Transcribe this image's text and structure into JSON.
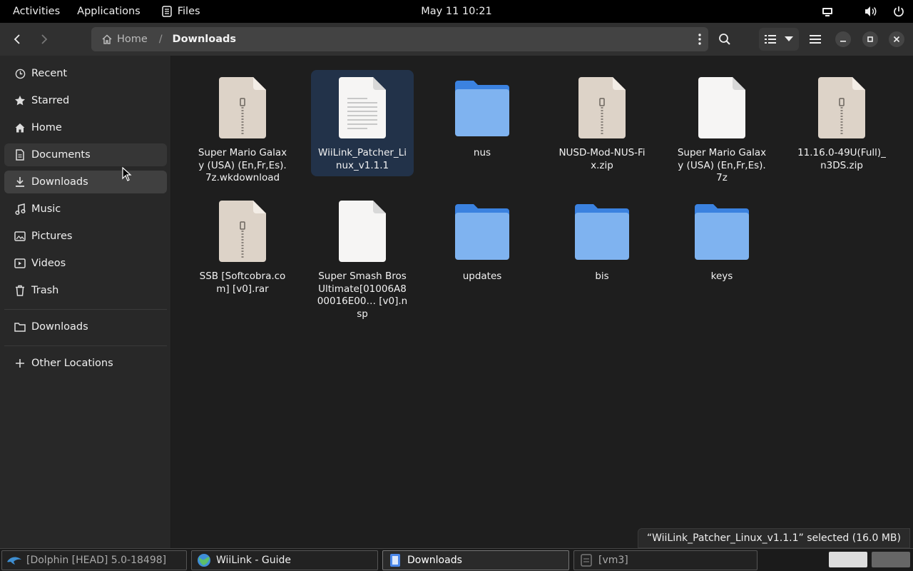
{
  "topbar": {
    "activities": "Activities",
    "applications": "Applications",
    "app_name": "Files",
    "clock": "May 11  10:21"
  },
  "header": {
    "breadcrumb_home": "Home",
    "breadcrumb_sep": "/",
    "breadcrumb_current": "Downloads"
  },
  "sidebar": {
    "items": [
      {
        "label": "Recent",
        "icon": "clock-icon"
      },
      {
        "label": "Starred",
        "icon": "star-icon"
      },
      {
        "label": "Home",
        "icon": "home-icon"
      },
      {
        "label": "Documents",
        "icon": "document-icon"
      },
      {
        "label": "Downloads",
        "icon": "download-icon"
      },
      {
        "label": "Music",
        "icon": "music-icon"
      },
      {
        "label": "Pictures",
        "icon": "picture-icon"
      },
      {
        "label": "Videos",
        "icon": "video-icon"
      },
      {
        "label": "Trash",
        "icon": "trash-icon"
      }
    ],
    "bookmark": {
      "label": "Downloads",
      "icon": "folder-icon"
    },
    "other_locations": {
      "label": "Other Locations",
      "icon": "plus-icon"
    }
  },
  "files": [
    {
      "name": "Super Mario Galaxy (USA) (En,Fr,Es).7z.wkdownload",
      "type": "archive"
    },
    {
      "name": "WiiLink_Patcher_Linux_v1.1.1",
      "type": "text",
      "selected": true
    },
    {
      "name": "nus",
      "type": "folder"
    },
    {
      "name": "NUSD-Mod-NUS-Fix.zip",
      "type": "archive"
    },
    {
      "name": "Super Mario Galaxy (USA) (En,Fr,Es).7z",
      "type": "blank"
    },
    {
      "name": "11.16.0-49U(Full)_n3DS.zip",
      "type": "archive"
    },
    {
      "name": "SSB [Softcobra.com] [v0].rar",
      "type": "archive"
    },
    {
      "name": "Super Smash Bros Ultimate[01006A800016E00… [v0].nsp",
      "type": "blank"
    },
    {
      "name": "updates",
      "type": "folder"
    },
    {
      "name": "bis",
      "type": "folder"
    },
    {
      "name": "keys",
      "type": "folder"
    }
  ],
  "status": "“WiiLink_Patcher_Linux_v1.1.1” selected  (16.0 MB)",
  "taskbar": {
    "tasks": [
      {
        "label": "[Dolphin [HEAD] 5.0-18498]",
        "icon": "dolphin-icon"
      },
      {
        "label": "WiiLink - Guide",
        "icon": "browser-icon"
      },
      {
        "label": "Downloads",
        "icon": "files-icon"
      },
      {
        "label": "[vm3]",
        "icon": "vm-icon"
      }
    ]
  },
  "colors": {
    "folder": "#7fb3f0",
    "folder_tab": "#3b82e0",
    "archive": "#ddd3c8",
    "selection": "#223249"
  }
}
